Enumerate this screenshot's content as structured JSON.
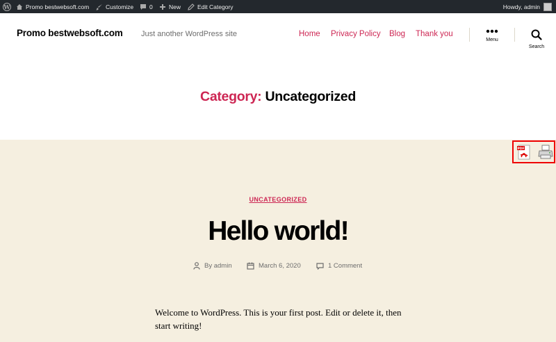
{
  "admin_bar": {
    "site_name": "Promo bestwebsoft.com",
    "customize": "Customize",
    "comments_count": "0",
    "new": "New",
    "edit_category": "Edit Category",
    "howdy": "Howdy, admin"
  },
  "header": {
    "site_title": "Promo bestwebsoft.com",
    "tagline": "Just another WordPress site",
    "nav": [
      "Home",
      "Privacy Policy",
      "Blog",
      "Thank you"
    ],
    "menu_label": "Menu",
    "search_label": "Search"
  },
  "archive": {
    "prefix": "Category:",
    "name": "Uncategorized"
  },
  "post": {
    "category": "UNCATEGORIZED",
    "title": "Hello world!",
    "author": "By admin",
    "date": "March 6, 2020",
    "comments": "1 Comment",
    "excerpt": "Welcome to WordPress. This is your first post. Edit or delete it, then start writing!"
  },
  "colors": {
    "accent": "#cd2653",
    "admin_bar_bg": "#23282d",
    "content_bg": "#f5efe0",
    "highlight_border": "#ee0000"
  },
  "icons": {
    "pdf": "pdf-icon",
    "print": "printer-icon"
  }
}
